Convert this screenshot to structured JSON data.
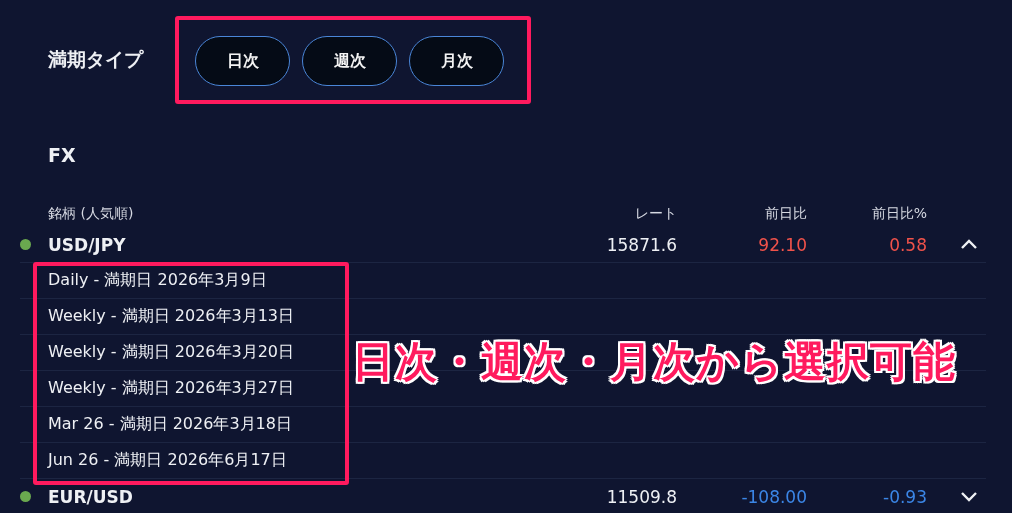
{
  "filter": {
    "label": "満期タイプ",
    "options": [
      {
        "label": "日次"
      },
      {
        "label": "週次"
      },
      {
        "label": "月次"
      }
    ]
  },
  "section_title": "FX",
  "table": {
    "columns": [
      "銘柄 (人気順)",
      "レート",
      "前日比",
      "前日比%"
    ],
    "rows": [
      {
        "symbol": "USD/JPY",
        "color": "#6aa84f",
        "rate": "15871.6",
        "change": "92.10",
        "change_pct": "0.58",
        "expanded": true,
        "children": [
          {
            "label": "Daily - 満期日 2026年3月9日"
          },
          {
            "label": "Weekly - 満期日 2026年3月13日"
          },
          {
            "label": "Weekly - 満期日 2026年3月20日"
          },
          {
            "label": "Weekly - 満期日 2026年3月27日"
          },
          {
            "label": "Mar 26 - 満期日 2026年3月18日"
          },
          {
            "label": "Jun 26 - 満期日 2026年6月17日"
          }
        ]
      },
      {
        "symbol": "EUR/USD",
        "color": "#6aa84f",
        "rate": "11509.8",
        "change": "-108.00",
        "change_pct": "-0.93",
        "expanded": false
      }
    ]
  },
  "annotation": "日次・週次・月次から選択可能"
}
